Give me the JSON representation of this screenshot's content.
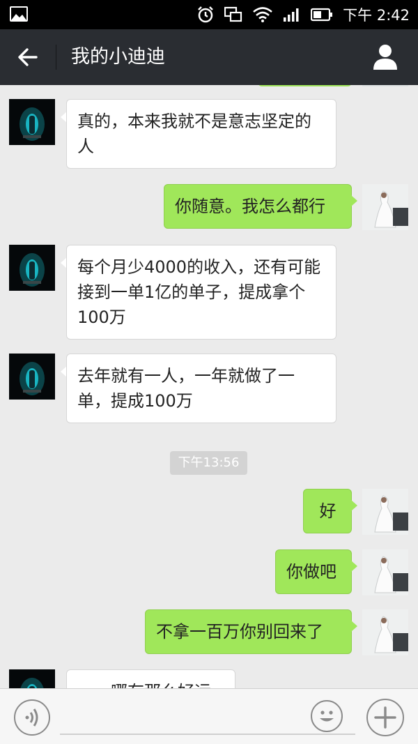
{
  "status_bar": {
    "time": "下午 2:42",
    "icons": [
      "gallery-icon",
      "alarm-icon",
      "screen-mirror-icon",
      "wifi-icon",
      "signal-icon",
      "battery-icon"
    ]
  },
  "header": {
    "title": "我的小迪迪",
    "back_icon": "arrow-left-icon",
    "profile_icon": "person-icon"
  },
  "messages": [
    {
      "side": "in",
      "text": "真的，本来我就不是意志坚定的人"
    },
    {
      "side": "out",
      "text": "你随意。我怎么都行"
    },
    {
      "side": "in",
      "text": "每个月少4000的收入，还有可能接到一单1亿的单子，提成拿个100万"
    },
    {
      "side": "in",
      "text": "去年就有一人，一年就做了一单，提成100万"
    },
    {
      "side": "out",
      "text": "好"
    },
    {
      "side": "out",
      "text": "你做吧"
    },
    {
      "side": "out",
      "text": "不拿一百万你别回来了"
    },
    {
      "side": "in",
      "text": "……哪有那么好运"
    }
  ],
  "timestamp": "下午13:56",
  "input_bar": {
    "voice_icon": "voice-icon",
    "emoji_icon": "smiley-icon",
    "more_icon": "plus-icon",
    "text_value": ""
  },
  "colors": {
    "nav_bg": "#2a2d32",
    "chat_bg": "#ebebeb",
    "out_bubble": "#a0e75a",
    "in_bubble": "#ffffff"
  }
}
